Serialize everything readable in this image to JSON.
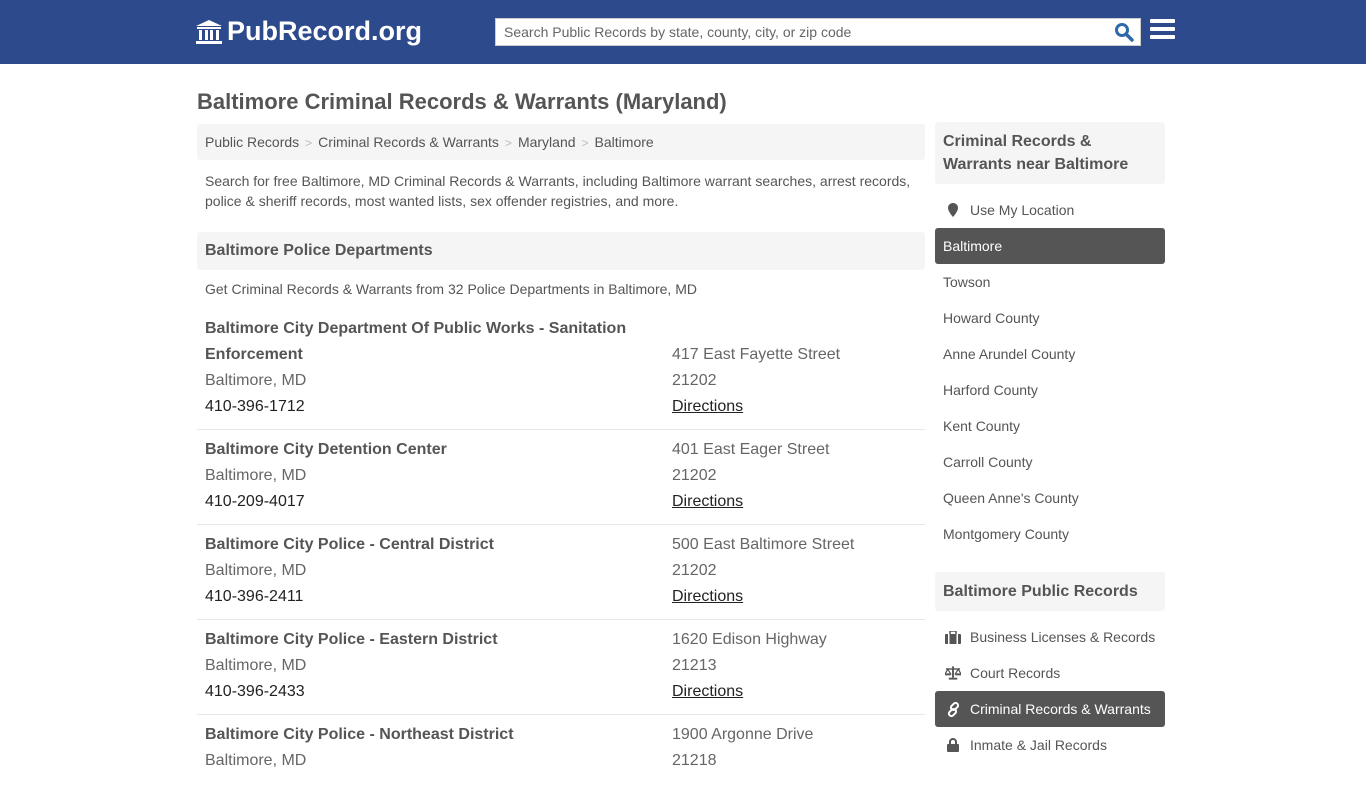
{
  "header": {
    "logo_text": "PubRecord.org",
    "search_placeholder": "Search Public Records by state, county, city, or zip code"
  },
  "page": {
    "title": "Baltimore Criminal Records & Warrants (Maryland)",
    "breadcrumb": [
      "Public Records",
      "Criminal Records & Warrants",
      "Maryland",
      "Baltimore"
    ],
    "intro": "Search for free Baltimore, MD Criminal Records & Warrants, including Baltimore warrant searches, arrest records, police & sheriff records, most wanted lists, sex offender registries, and more."
  },
  "section": {
    "title": "Baltimore Police Departments",
    "subtitle": "Get Criminal Records & Warrants from 32 Police Departments in Baltimore, MD"
  },
  "listings": [
    {
      "name": "Baltimore City Department Of Public Works - Sanitation Enforcement",
      "city": "Baltimore, MD",
      "phone": "410-396-1712",
      "address": "417 East Fayette Street",
      "zip": "21202",
      "link": "Directions"
    },
    {
      "name": "Baltimore City Detention Center",
      "city": "Baltimore, MD",
      "phone": "410-209-4017",
      "address": "401 East Eager Street",
      "zip": "21202",
      "link": "Directions"
    },
    {
      "name": "Baltimore City Police - Central District",
      "city": "Baltimore, MD",
      "phone": "410-396-2411",
      "address": "500 East Baltimore Street",
      "zip": "21202",
      "link": "Directions"
    },
    {
      "name": "Baltimore City Police - Eastern District",
      "city": "Baltimore, MD",
      "phone": "410-396-2433",
      "address": "1620 Edison Highway",
      "zip": "21213",
      "link": "Directions"
    },
    {
      "name": "Baltimore City Police - Northeast District",
      "city": "Baltimore, MD",
      "phone": "",
      "address": "1900 Argonne Drive",
      "zip": "21218",
      "link": ""
    }
  ],
  "sidebar": {
    "near_title": "Criminal Records & Warrants near Baltimore",
    "use_location": "Use My Location",
    "near_items": [
      "Baltimore",
      "Towson",
      "Howard County",
      "Anne Arundel County",
      "Harford County",
      "Kent County",
      "Carroll County",
      "Queen Anne's County",
      "Montgomery County"
    ],
    "active_near": "Baltimore",
    "records_title": "Baltimore Public Records",
    "records_items": [
      {
        "label": "Business Licenses & Records",
        "icon": "briefcase-icon"
      },
      {
        "label": "Court Records",
        "icon": "scales-icon"
      },
      {
        "label": "Criminal Records & Warrants",
        "icon": "link-icon",
        "active": true
      },
      {
        "label": "Inmate & Jail Records",
        "icon": "lock-icon"
      }
    ]
  }
}
